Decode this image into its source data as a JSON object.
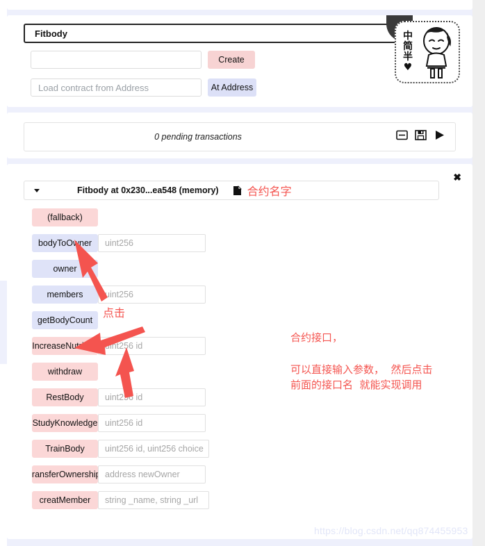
{
  "deploy": {
    "selected_contract": "Fitbody",
    "constructor_args_placeholder": "",
    "constructor_args_value": "",
    "create_label": "Create",
    "address_placeholder": "Load contract from Address",
    "address_value": "",
    "at_address_label": "At Address"
  },
  "transactions": {
    "status": "0 pending transactions",
    "icons": [
      "minus-box-icon",
      "save-icon",
      "play-icon"
    ]
  },
  "instance": {
    "close_label": "✖",
    "caret": "chevron-down-icon",
    "title": "Fitbody at 0x230...ea548 (memory)",
    "copy_icon": "copy-icon",
    "functions": [
      {
        "name": "(fallback)",
        "kind": "write",
        "input": null
      },
      {
        "name": "bodyToOwner",
        "kind": "view",
        "input": "uint256"
      },
      {
        "name": "owner",
        "kind": "view",
        "input": null
      },
      {
        "name": "members",
        "kind": "view",
        "input": "uint256"
      },
      {
        "name": "getBodyCount",
        "kind": "view",
        "input": null
      },
      {
        "name": "IncreaseNutrition",
        "kind": "write",
        "input": "uint256 id"
      },
      {
        "name": "withdraw",
        "kind": "write",
        "input": null
      },
      {
        "name": "RestBody",
        "kind": "write",
        "input": "uint256 id"
      },
      {
        "name": "StudyKnowledge",
        "kind": "write",
        "input": "uint256 id"
      },
      {
        "name": "TrainBody",
        "kind": "write",
        "input": "uint256 id, uint256 choice"
      },
      {
        "name": "transferOwnership",
        "kind": "write",
        "input": "address newOwner"
      },
      {
        "name": "creatMember",
        "kind": "write",
        "input": "string _name, string _url"
      }
    ]
  },
  "annotations": {
    "contract_name": "合约名字",
    "click": "点击",
    "interface": "合约接口，",
    "detail": "可以直接输入参数，  然后点击\n前面的接口名  就能实现调用"
  },
  "sticker": {
    "text_lines": "中\n简\n半\n♥"
  },
  "watermark": "https://blog.csdn.net/qq874455953",
  "colors": {
    "background": "#eef0fc",
    "view_button": "#dfe3f8",
    "write_button": "#fbd7d7",
    "annotation_red": "#f4544f"
  }
}
